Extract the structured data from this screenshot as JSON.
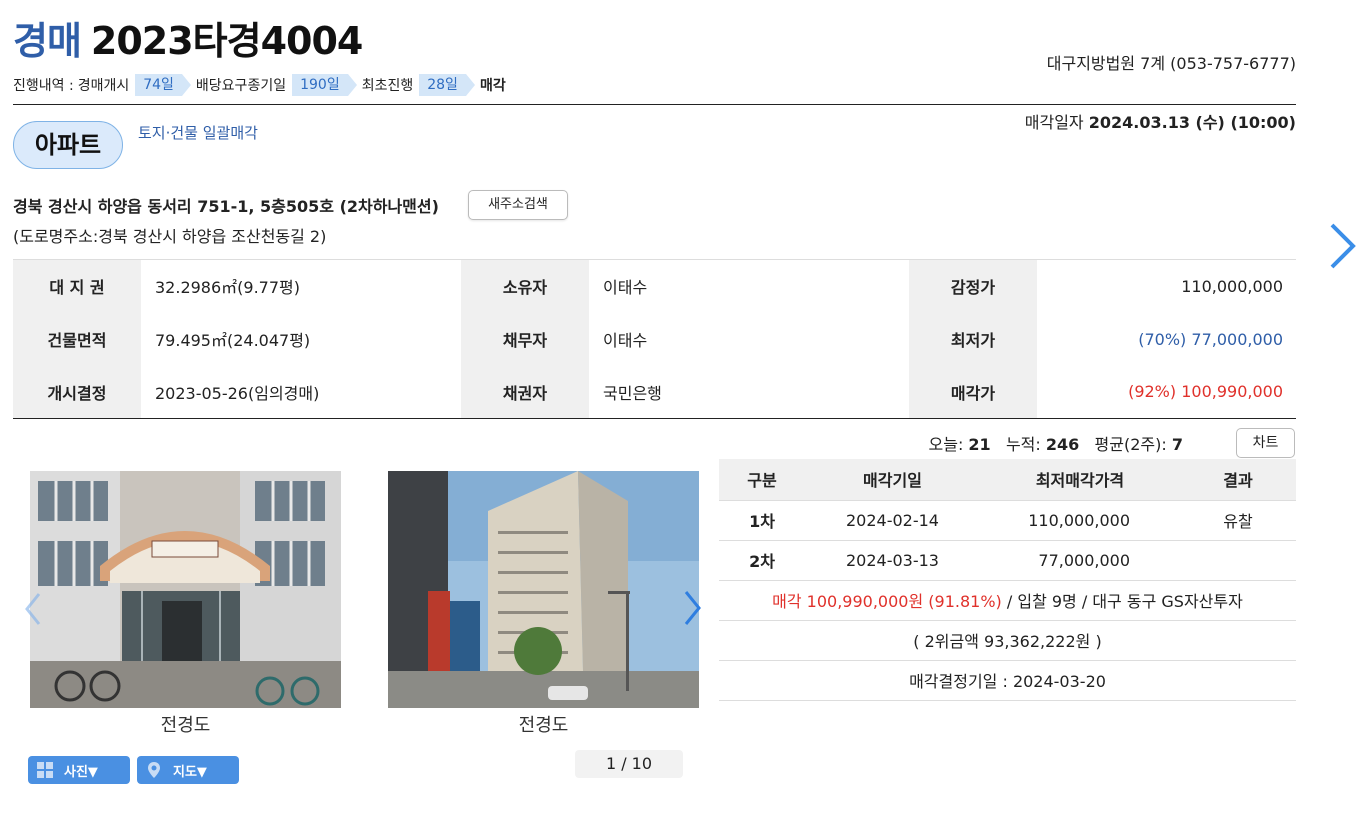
{
  "header": {
    "kind": "경매",
    "case_number": "2023타경4004",
    "court": "대구지방법원 7계 (053-757-6777)"
  },
  "progress": {
    "label": "진행내역 : ",
    "steps": [
      {
        "name": "경매개시",
        "days": "74일"
      },
      {
        "name": "배당요구종기일",
        "days": "190일"
      },
      {
        "name": "최초진행",
        "days": "28일"
      }
    ],
    "final": "매각"
  },
  "property": {
    "type": "아파트",
    "bulk_sale": "토지·건물 일괄매각",
    "sale_date_label": "매각일자 ",
    "sale_date": "2024.03.13 (수) (10:00)",
    "address": "경북 경산시 하양읍 동서리 751-1, 5층505호 (2차하나맨션)",
    "new_address_button": "새주소검색",
    "road_address": "(도로명주소:경북 경산시 하양읍 조산천동길 2)"
  },
  "info": {
    "land_right_label": "대 지 권",
    "land_right": "32.2986㎡(9.77평)",
    "owner_label": "소유자",
    "owner": "이태수",
    "appraisal_label": "감정가",
    "appraisal": "110,000,000",
    "building_area_label": "건물면적",
    "building_area": "79.495㎡(24.047평)",
    "debtor_label": "채무자",
    "debtor": "이태수",
    "minimum_label": "최저가",
    "minimum": "(70%) 77,000,000",
    "start_decision_label": "개시결정",
    "start_decision": "2023-05-26(임의경매)",
    "creditor_label": "채권자",
    "creditor": "국민은행",
    "sale_price_label": "매각가",
    "sale_price": "(92%) 100,990,000"
  },
  "stats": {
    "today_label": "오늘: ",
    "today": "21",
    "total_label": "누적: ",
    "total": "246",
    "avg_label": "평균(2주): ",
    "avg": "7",
    "chart_button": "차트"
  },
  "photos": {
    "items": [
      {
        "caption": "전경도"
      },
      {
        "caption": "전경도"
      }
    ],
    "photo_button": "사진▼",
    "map_button": "지도▼",
    "pager": "1 / 10"
  },
  "bids": {
    "headers": [
      "구분",
      "매각기일",
      "최저매각가격",
      "결과"
    ],
    "rows": [
      {
        "round": "1차",
        "date": "2024-02-14",
        "price": "110,000,000",
        "result": "유찰"
      },
      {
        "round": "2차",
        "date": "2024-03-13",
        "price": "77,000,000",
        "result": ""
      }
    ],
    "sale_result_red": "매각 100,990,000원 (91.81%)",
    "sale_result_rest": " / 입찰 9명 / 대구 동구 GS자산투자",
    "second_bid": "( 2위금액 93,362,222원 )",
    "decision_date": "매각결정기일 : 2024-03-20"
  },
  "colors": {
    "accent_blue": "#2f5ea8",
    "sale_red": "#e0312b",
    "button_blue": "#4a90e2"
  }
}
